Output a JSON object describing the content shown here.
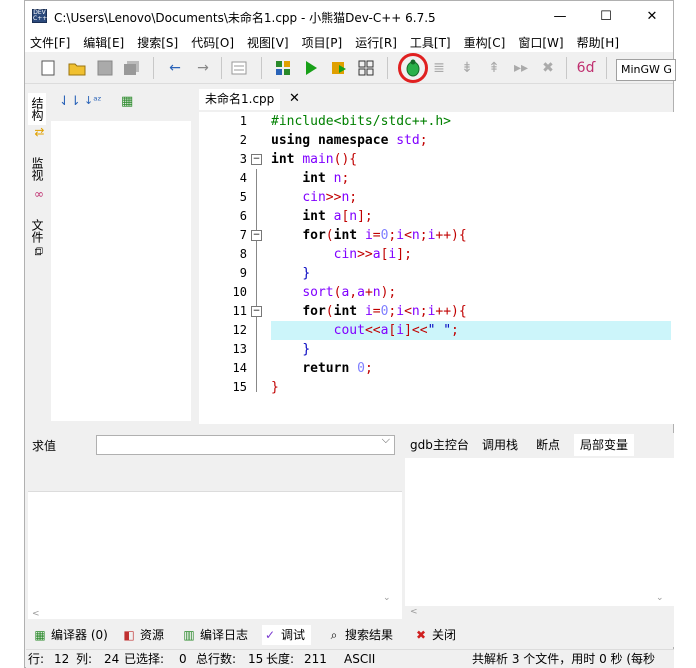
{
  "window": {
    "title": "C:\\Users\\Lenovo\\Documents\\未命名1.cpp - 小熊猫Dev-C++ 6.7.5",
    "minimize": "—",
    "maximize": "☐",
    "close": "✕"
  },
  "menu": [
    "文件[F]",
    "编辑[E]",
    "搜索[S]",
    "代码[O]",
    "视图[V]",
    "项目[P]",
    "运行[R]",
    "工具[T]",
    "重构[C]",
    "窗口[W]",
    "帮助[H]"
  ],
  "toolbar": {
    "compiler": "MinGW G"
  },
  "side_tabs": [
    "结构",
    "监视",
    "文件"
  ],
  "file_tab": {
    "name": "未命名1.cpp",
    "close": "✕"
  },
  "code_lines": [
    {
      "n": "1",
      "text": "#include<bits/stdc++.h>"
    },
    {
      "n": "2",
      "text": "using namespace std;"
    },
    {
      "n": "3",
      "text": "int main(){"
    },
    {
      "n": "4",
      "text": "    int n;"
    },
    {
      "n": "5",
      "text": "    cin>>n;"
    },
    {
      "n": "6",
      "text": "    int a[n];"
    },
    {
      "n": "7",
      "text": "    for(int i=0;i<n;i++){"
    },
    {
      "n": "8",
      "text": "        cin>>a[i];"
    },
    {
      "n": "9",
      "text": "    }"
    },
    {
      "n": "10",
      "text": "    sort(a,a+n);"
    },
    {
      "n": "11",
      "text": "    for(int i=0;i<n;i++){"
    },
    {
      "n": "12",
      "text": "        cout<<a[i]<<\" \";"
    },
    {
      "n": "13",
      "text": "    }"
    },
    {
      "n": "14",
      "text": "    return 0;"
    },
    {
      "n": "15",
      "text": "}"
    }
  ],
  "evaluate": {
    "label": "求值"
  },
  "debug_tabs": [
    "gdb主控台",
    "调用栈",
    "断点",
    "局部变量"
  ],
  "bottom_tabs": [
    {
      "label": "编译器 (0)",
      "icon": "grid-icon"
    },
    {
      "label": "资源",
      "icon": "resource-icon"
    },
    {
      "label": "编译日志",
      "icon": "chart-icon"
    },
    {
      "label": "调试",
      "icon": "check-icon"
    },
    {
      "label": "搜索结果",
      "icon": "search-icon"
    },
    {
      "label": "关闭",
      "icon": "close-icon"
    }
  ],
  "status": {
    "row_label": "行:",
    "row": "12",
    "col_label": "列:",
    "col": "24",
    "sel_label": "已选择:",
    "sel": "0",
    "total_label": "总行数:",
    "total": "15",
    "len_label": "长度:",
    "len": "211",
    "encoding": "ASCII",
    "parse": "共解析 3 个文件，用时 0 秒 (每秒"
  }
}
